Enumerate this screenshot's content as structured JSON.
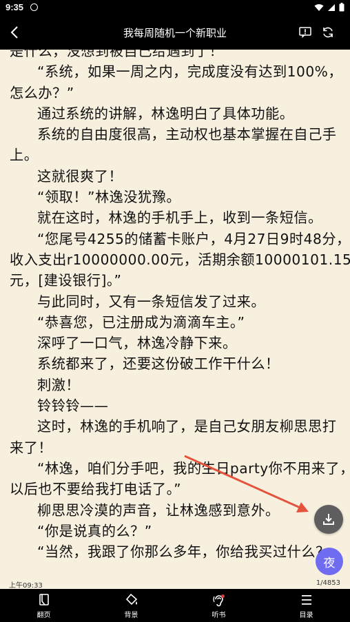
{
  "status_bar": {
    "time": "9:35"
  },
  "header": {
    "title": "我每周随机一个新职业"
  },
  "reader": {
    "lines": [
      {
        "text": "是什么，没想到被自己给遇到了！",
        "indent": false
      },
      {
        "text": "“系统，如果一周之内，完成度没有达到100%，",
        "indent": true
      },
      {
        "text": "怎么办？”",
        "indent": false
      },
      {
        "text": "通过系统的讲解，林逸明白了具体功能。",
        "indent": true
      },
      {
        "text": "系统的自由度很高，主动权也基本掌握在自己手",
        "indent": true
      },
      {
        "text": "上。",
        "indent": false
      },
      {
        "text": "这就很爽了！",
        "indent": true
      },
      {
        "text": "“领取！”林逸没犹豫。",
        "indent": true
      },
      {
        "text": "就在这时，林逸的手机手上，收到一条短信。",
        "indent": true
      },
      {
        "text": "“您尾号4255的储蓄卡账户，4月27日9时48分，",
        "indent": true
      },
      {
        "text": "收入支出r10000000.00元，活期余额10000101.15",
        "indent": false
      },
      {
        "text": "元，[建设银行]。”",
        "indent": false
      },
      {
        "text": "与此同时，又有一条短信发了过来。",
        "indent": true
      },
      {
        "text": "“恭喜您，已注册成为滴滴车主。”",
        "indent": true
      },
      {
        "text": "深呼了一口气，林逸冷静下来。",
        "indent": true
      },
      {
        "text": "系统都来了，还要这份破工作干什么！",
        "indent": true
      },
      {
        "text": "刺激！",
        "indent": true
      },
      {
        "text": "铃铃铃——",
        "indent": true
      },
      {
        "text": "这时，林逸的手机响了，是自己女朋友柳思思打",
        "indent": true
      },
      {
        "text": "来了！",
        "indent": false
      },
      {
        "text": "“林逸，咱们分手吧，我的生日party你不用来了，",
        "indent": true
      },
      {
        "text": "以后也不要给我打电话了。”",
        "indent": false
      },
      {
        "text": "柳思思冷漠的声音，让林逸感到意外。",
        "indent": true
      },
      {
        "text": "“你是说真的么？”",
        "indent": true
      },
      {
        "text": "“当然，我跟了你那么多年，你给我买过什么？",
        "indent": true
      }
    ],
    "clock": "上午09:33",
    "page_indicator": "1/4853"
  },
  "floating": {
    "night_label": "夜",
    "download_icon": "download-icon"
  },
  "bottom_nav": {
    "items": [
      {
        "label": "翻页",
        "icon": "page-flip-icon"
      },
      {
        "label": "背景",
        "icon": "background-icon"
      },
      {
        "label": "听书",
        "icon": "listen-icon"
      },
      {
        "label": "目录",
        "icon": "catalog-icon"
      }
    ]
  },
  "colors": {
    "page_bg": "#f7f0df",
    "bar_bg": "#000000",
    "night_button": "#6f6cf2",
    "download_button": "#5e5e5e",
    "annotation_arrow": "#e5533d"
  }
}
